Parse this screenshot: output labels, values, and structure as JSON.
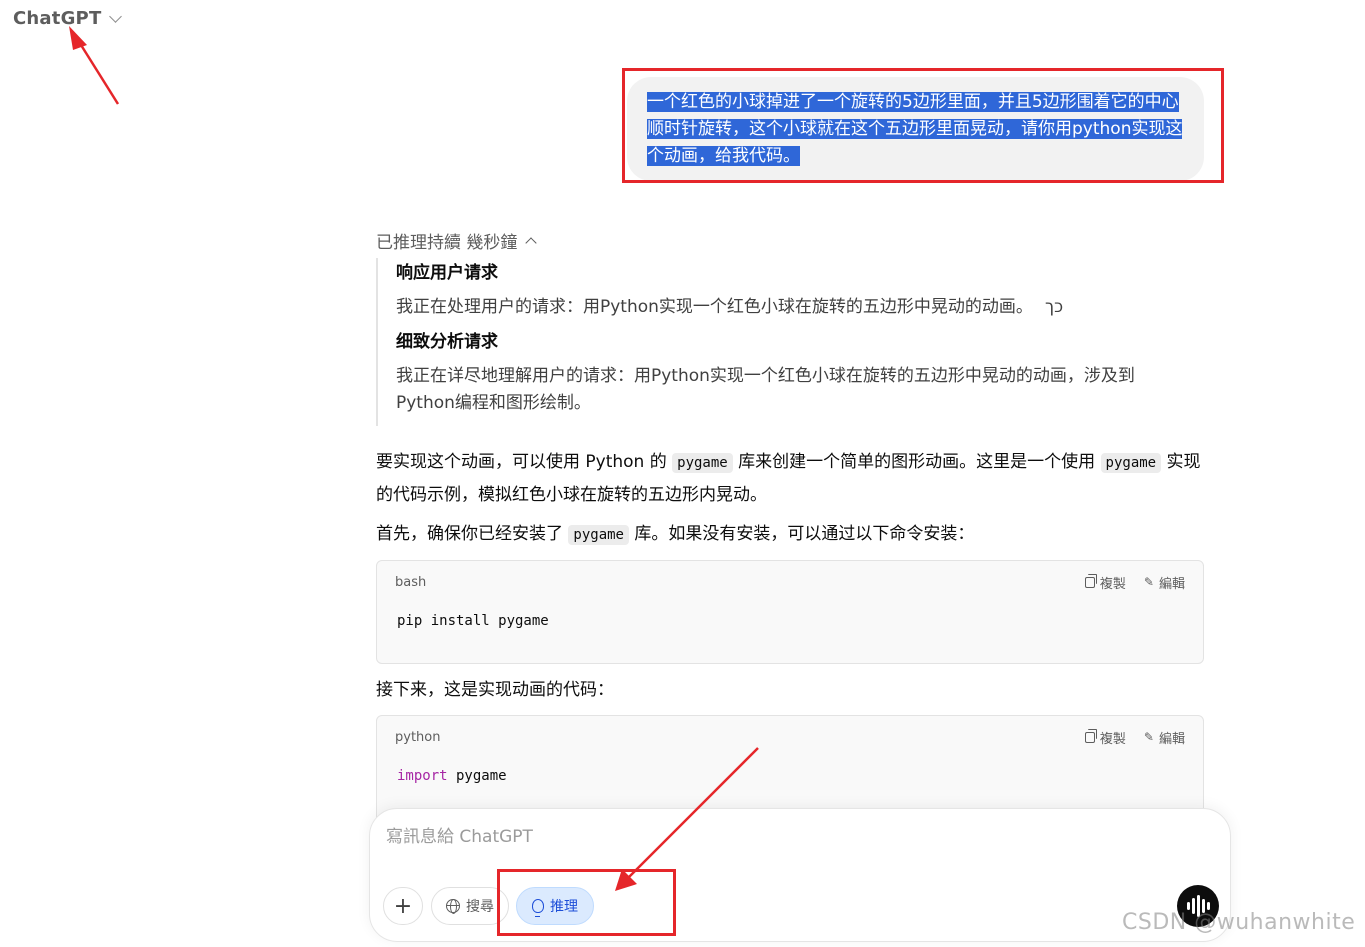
{
  "header": {
    "title": "ChatGPT"
  },
  "user_message": {
    "text": "一个红色的小球掉进了一个旋转的5边形里面，并且5边形围着它的中心顺时针旋转，这个小球就在这个五边形里面晃动，请你用python实现这个动画，给我代码。"
  },
  "reasoning": {
    "toggle_label": "已推理持續 幾秒鐘",
    "steps": [
      {
        "heading": "响应用户请求",
        "body": "我正在处理用户的请求：用Python实现一个红色小球在旋转的五边形中晃动的动画。",
        "tail": "כך"
      },
      {
        "heading": "细致分析请求",
        "body": "我正在详尽地理解用户的请求：用Python实现一个红色小球在旋转的五边形中晃动的动画，涉及到Python编程和图形绘制。",
        "tail": ""
      }
    ]
  },
  "answer": {
    "p1_a": "要实现这个动画，可以使用 Python 的 ",
    "p1_code1": "pygame",
    "p1_b": " 库来创建一个简单的图形动画。这里是一个使用 ",
    "p1_code2": "pygame",
    "p1_c": " 实现的代码示例，模拟红色小球在旋转的五边形内晃动。",
    "p2_a": "首先，确保你已经安装了 ",
    "p2_code": "pygame",
    "p2_b": " 库。如果没有安装，可以通过以下命令安装：",
    "p3": "接下来，这是实现动画的代码："
  },
  "code_blocks": [
    {
      "lang": "bash",
      "copy_label": "複製",
      "edit_label": "編輯",
      "line_plain": "pip install pygame"
    },
    {
      "lang": "python",
      "copy_label": "複製",
      "edit_label": "編輯",
      "line_keyword": "import",
      "line_rest": " pygame"
    }
  ],
  "composer": {
    "placeholder": "寫訊息給 ChatGPT",
    "plus_label": "+",
    "search_label": "搜尋",
    "reason_label": "推理"
  },
  "watermark": "CSDN @wuhanwhite",
  "colors": {
    "annotation_red": "#e5262a",
    "selection_blue": "#2f67d8",
    "reason_active_bg": "#dbeafe"
  }
}
